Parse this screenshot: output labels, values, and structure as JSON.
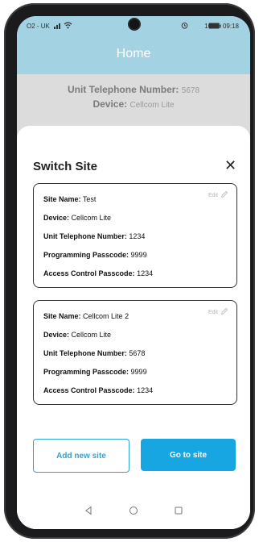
{
  "status": {
    "left": "O2 - UK",
    "right": "100% 09:18"
  },
  "appbar": {
    "title": "Home"
  },
  "unit": {
    "tel_label": "Unit Telephone Number:",
    "tel_value": "5678",
    "device_label": "Device:",
    "device_value": "Cellcom Lite"
  },
  "sheet": {
    "title": "Switch Site",
    "close_glyph": "✕",
    "sites": [
      {
        "edit_label": "Edit",
        "site_name_label": "Site Name:",
        "site_name": "Test",
        "device_label": "Device:",
        "device": "Cellcom Lite",
        "unit_tel_label": "Unit Telephone Number:",
        "unit_tel": "1234",
        "prog_label": "Programming Passcode:",
        "prog": "9999",
        "access_label": "Access Control Passcode:",
        "access": "1234"
      },
      {
        "edit_label": "Edit",
        "site_name_label": "Site Name:",
        "site_name": "Cellcom Lite 2",
        "device_label": "Device:",
        "device": "Cellcom Lite",
        "unit_tel_label": "Unit Telephone Number:",
        "unit_tel": "5678",
        "prog_label": "Programming Passcode:",
        "prog": "9999",
        "access_label": "Access Control Passcode:",
        "access": "1234"
      }
    ],
    "add_button": "Add new site",
    "go_button": "Go to site"
  },
  "colors": {
    "header": "#a3d3e3",
    "accent": "#18a6e3"
  },
  "icons": [
    "signal-icon",
    "wifi-icon",
    "alarm-icon",
    "battery-icon",
    "pencil-icon",
    "close-icon",
    "back-icon",
    "home-icon",
    "recents-icon"
  ]
}
